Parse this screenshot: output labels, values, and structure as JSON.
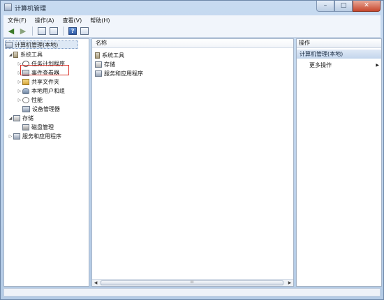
{
  "window": {
    "title": "计算机管理",
    "controls": {
      "minimize": "–",
      "maximize": "□",
      "close": "✕"
    }
  },
  "menu": [
    {
      "label": "文件(F)"
    },
    {
      "label": "操作(A)"
    },
    {
      "label": "查看(V)"
    },
    {
      "label": "帮助(H)"
    }
  ],
  "toolbar": {
    "back_icon": "back-arrow-icon",
    "forward_icon": "forward-arrow-icon",
    "help_glyph": "?"
  },
  "tree": {
    "root": "计算机管理(本地)",
    "system_tools": "系统工具",
    "task_scheduler": "任务计划程序",
    "event_viewer": "事件查看器",
    "shared_folders": "共享文件夹",
    "local_users": "本地用户和组",
    "performance": "性能",
    "device_manager": "设备管理器",
    "storage": "存储",
    "disk_management": "磁盘管理",
    "services": "服务和应用程序"
  },
  "center": {
    "column_name": "名称",
    "items": [
      {
        "label": "系统工具"
      },
      {
        "label": "存储"
      },
      {
        "label": "服务和应用程序"
      }
    ],
    "scroll_thumb_glyph": "III"
  },
  "actions": {
    "header": "操作",
    "section": "计算机管理(本地)",
    "more": "更多操作"
  },
  "colors": {
    "highlight": "#d9352c",
    "title_bg": "#b9d1ea"
  }
}
